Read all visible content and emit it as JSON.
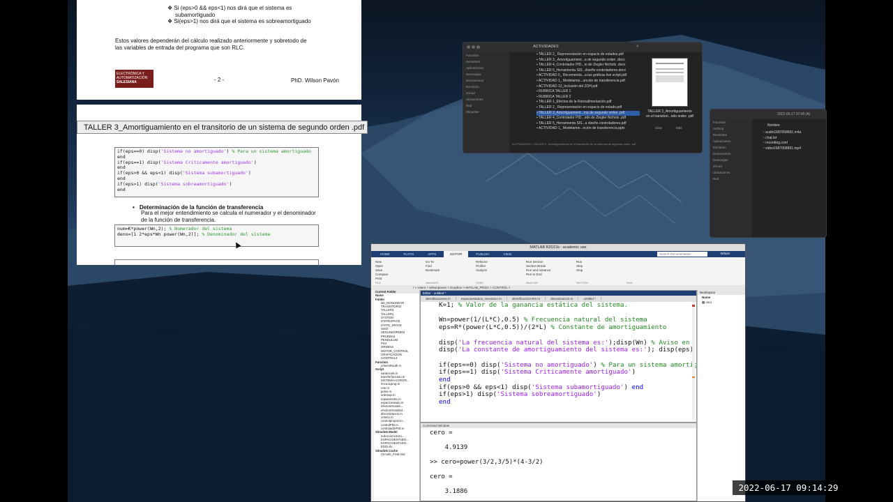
{
  "pdf": {
    "page_top": {
      "bullet1": "Si (eps>0 && eps<1) nos dirá que el sistema es",
      "bullet1b": "subamortiguado",
      "bullet2": "Si(eps>1) nos dirá que el sistema es sobreamortiguado",
      "paragraph1": "Estos valores dependerán del cálculo realizado anteriormente y sobretodo de",
      "paragraph2": "las variables de entrada del programa que son RLC.",
      "logo_line1": "ELECTRÓNICA Y",
      "logo_line2": "AUTOMATIZACIÓN",
      "logo_line3": "SALESIANA",
      "page_number": "- 2 -",
      "author": "PhD. Wilson Pavón"
    },
    "tooltip": "TALLER 3_Amortiguamiento en el transitorio de un sistema de segundo orden .pdf",
    "page_second": {
      "code1": [
        {
          "a": "if(eps==0) disp(",
          "s": "'Sistema no amortiguado'",
          "b": ") ",
          "c": "% Para un sistema amortiguado"
        },
        {
          "a": "end",
          "s": "",
          "b": "",
          "c": ""
        },
        {
          "a": "if(eps==1) disp(",
          "s": "'Sistema Criticamente amortiguado'",
          "b": ")",
          "c": ""
        },
        {
          "a": "end",
          "s": "",
          "b": "",
          "c": ""
        },
        {
          "a": "if(eps>0 && eps<1) disp(",
          "s": "'Sistema subamortiguado'",
          "b": ")",
          "c": ""
        },
        {
          "a": "end",
          "s": "",
          "b": "",
          "c": ""
        },
        {
          "a": "if(eps>1) disp(",
          "s": "'Sistema sobreamortiguado'",
          "b": ")",
          "c": ""
        },
        {
          "a": "end",
          "s": "",
          "b": "",
          "c": ""
        }
      ],
      "heading": "Determinación de la función de transferencia",
      "para1": "Para el mejor entendimiento se calcula el numerador y el denominador",
      "para2": "de la función de transferencia.",
      "code2": [
        {
          "a": "num=K*power(Wn,2); ",
          "c": "% Numerador del sistema"
        },
        {
          "a": "deno=[1 2*eps*Wn power(Wn,2)]; ",
          "c": "% Denominador del sistema"
        }
      ]
    }
  },
  "finder1": {
    "title": "ACTIVIDADES",
    "sidebar": [
      "Favoritos",
      "Recientes",
      "Aplicaciones",
      "Descargas",
      "Documentos",
      "Escritorio",
      "iCloud",
      "Ubicaciones",
      "Red",
      "Etiquetas"
    ],
    "files": [
      "TALLER 2_ Representación en espacio de estados.pdf",
      "TALLER 3_ Amortiguamient...a de segundo orden .docx",
      "TALLER 4_Controlador PID...to de Ziegler Nichols .docx",
      "TALLER 5_Herramienta SIS...diseño controladores.docx",
      "ACTIVIDAD 0_ Recomenda...a las gráficas live script.pdf",
      "ACTIVIDAD 1_ Modelamie...unción de transferencia.pdf",
      "ACTIVIDAD 12_Inclusión del ZOH.pdf",
      "RUBRICA TALLER 1",
      "RUBRICA TALLER 2",
      "TALLER 1_Efectos de la Retroalimentación.pdf",
      "TALLER 2_ Representación en espacio de estado.pdf",
      "TALLER 3_Amortiguamient...ma de segundo orden .pdf",
      "TALLER 4_Controlador PID...odo de Ziegler Nichols .pdf",
      "TALLER 5_Herramienta SIS...a diseño controladores.pdf",
      "ACTIVIDAD 1_ Modelamie...nción de transferencia.pptx"
    ],
    "selected_index": 11,
    "preview_caption1": "TALLER 3_Amortiguamiento",
    "preview_caption2": "en el transitori...ndo orden .pdf",
    "preview_btn1": "Girar",
    "preview_btn2": "Más",
    "path": "ACTIVIDADES > TALLER 3_Amortiguamiento en el transitorio de un sistema de segundo orden .pdf"
  },
  "finder2": {
    "title": "2022-06-17 07:46 (A)",
    "header": "Nombre",
    "files": [
      "audio1687058691.m4a",
      "chat.txt",
      "recording.conf",
      "video1687058891.mp4"
    ],
    "sidebar": [
      "Favoritos",
      "AirDrop",
      "Recientes",
      "Aplicaciones",
      "Escritorio",
      "Documentos",
      "Descargas",
      "iCloud",
      "Ubicaciones",
      "Red"
    ]
  },
  "matlab": {
    "title": "MATLAB R2021b - academic use",
    "tabs": [
      "HOME",
      "PLOTS",
      "APPS",
      "EDITOR",
      "PUBLISH",
      "VIEW"
    ],
    "active_tab": "EDITOR",
    "search_placeholder": "Search Documentation",
    "user": "Wilson",
    "ribbon_groups": [
      {
        "label": "FILE",
        "items": [
          "New",
          "Open",
          "Save",
          "Compare",
          "Print"
        ]
      },
      {
        "label": "NAVIGATE",
        "items": [
          "Go To",
          "Find",
          "Bookmark"
        ]
      },
      {
        "label": "CODE",
        "items": [
          "Refactor",
          "Profiler",
          "Analyze"
        ]
      },
      {
        "label": "ANALYZE",
        "items": [
          "Run Section",
          "Section Break",
          "Run and Advance",
          "Run to End"
        ]
      },
      {
        "label": "SECTION",
        "items": [
          "Run",
          "Step",
          "Stop"
        ]
      },
      {
        "label": "RUN",
        "items": []
      }
    ],
    "path": "/ > Users > wilsonpavon > Dropbox > MATLAB_PROG > CONTROL >",
    "current_folder": {
      "title": "Current Folder",
      "header": "Name",
      "sections": [
        {
          "label": "Folder",
          "items": [
            "lab_NONLINEAR",
            "TRANSITORIO",
            "TALLER3",
            "TALLER1",
            "SYSTEM",
            "STATESPACE",
            "STATE_SPACE",
            "SISO",
            "SEGUNDORDEN",
            "PRUEBA3",
            "PENDULUM",
            "PS4",
            "ORDEN2",
            "MOTOR_CONTROL",
            "GRAFICACION",
            "CONTROL3"
          ]
        },
        {
          "label": "Function",
          "items": [
            "criterioRouth.m"
          ]
        },
        {
          "label": "Script",
          "items": [
            "variacionk.m",
            "transferfunction.m",
            "SISTEMAACONTR...",
            "rlocus1prog.m",
            "rele.m",
            "polos.m",
            "ordenup.m",
            "masaresorte.m",
            "espacioestado.m",
            "efectoretroalim...",
            "efectoretroalimd...",
            "discretizacion.m",
            "criterio.m",
            "controlproporcio...",
            "controlPID.m",
            "controladorPID.m"
          ]
        },
        {
          "label": "Simulink Model",
          "items": [
            "reduccioncircito...",
            "ESPACIOESTADO...",
            "ESPACIOESTADO...",
            "EDIS.slx"
          ]
        },
        {
          "label": "Simulink Cache",
          "items": [
            "Circuito_Final.slxc"
          ]
        }
      ]
    },
    "editor": {
      "title": "Editor - untitled *",
      "tabs": [
        "identificaciones.m",
        "espacioestados_mecanico.m",
        "identificacionARX.m",
        "discretizacion.m",
        "untitled *"
      ],
      "lines": [
        [
          [
            "t",
            "K=1; "
          ],
          [
            "c",
            "% Valor de la ganancia estática del sistema."
          ]
        ],
        [],
        [
          [
            "t",
            "Wn=power(1/(L*C),0.5) "
          ],
          [
            "c",
            "% Frecuencia natural del sistema"
          ]
        ],
        [
          [
            "t",
            "eps=R*(power(L*C,0.5))/(2*L) "
          ],
          [
            "c",
            "% Constante de amortiguamiento"
          ]
        ],
        [],
        [
          [
            "t",
            "disp("
          ],
          [
            "s",
            "'La frecuencia natural del sistema es:'"
          ],
          [
            "t",
            ");disp(Wn) "
          ],
          [
            "c",
            "% Aviso en"
          ]
        ],
        [
          [
            "t",
            "disp("
          ],
          [
            "s",
            "'La constante de amortiguamiento del sistema es:'"
          ],
          [
            "t",
            "); disp(eps)"
          ]
        ],
        [],
        [
          [
            "t",
            "if(eps==0) disp("
          ],
          [
            "s",
            "'Sistema no amortiguado'"
          ],
          [
            "t",
            ") "
          ],
          [
            "c",
            "% Para un sistema amortig"
          ]
        ],
        [
          [
            "t",
            "if(eps==1) disp("
          ],
          [
            "s",
            "'Sistema Criticamente amortiguado'"
          ],
          [
            "t",
            ")"
          ]
        ],
        [
          [
            "k",
            "end"
          ]
        ],
        [
          [
            "t",
            "if(eps>0 && eps<1) disp("
          ],
          [
            "s",
            "'Sistema subamortiguado'"
          ],
          [
            "t",
            ") "
          ],
          [
            "k",
            "end"
          ]
        ],
        [
          [
            "t",
            "if(eps>1) disp("
          ],
          [
            "s",
            "'Sistema sobreamortiguado'"
          ],
          [
            "t",
            ")"
          ]
        ],
        [
          [
            "k",
            "end"
          ]
        ]
      ]
    },
    "command_window": {
      "title": "Command Window",
      "lines": [
        "cero =",
        "",
        "    4.9139",
        "",
        ">> cero=power(3/2,3/5)*(4-3/2)",
        "",
        "cero =",
        "",
        "    3.1886"
      ]
    },
    "workspace": {
      "title": "Workspace",
      "header": "Name",
      "vars": [
        "cero"
      ]
    }
  },
  "timestamp": "2022-06-17  09:14:29"
}
